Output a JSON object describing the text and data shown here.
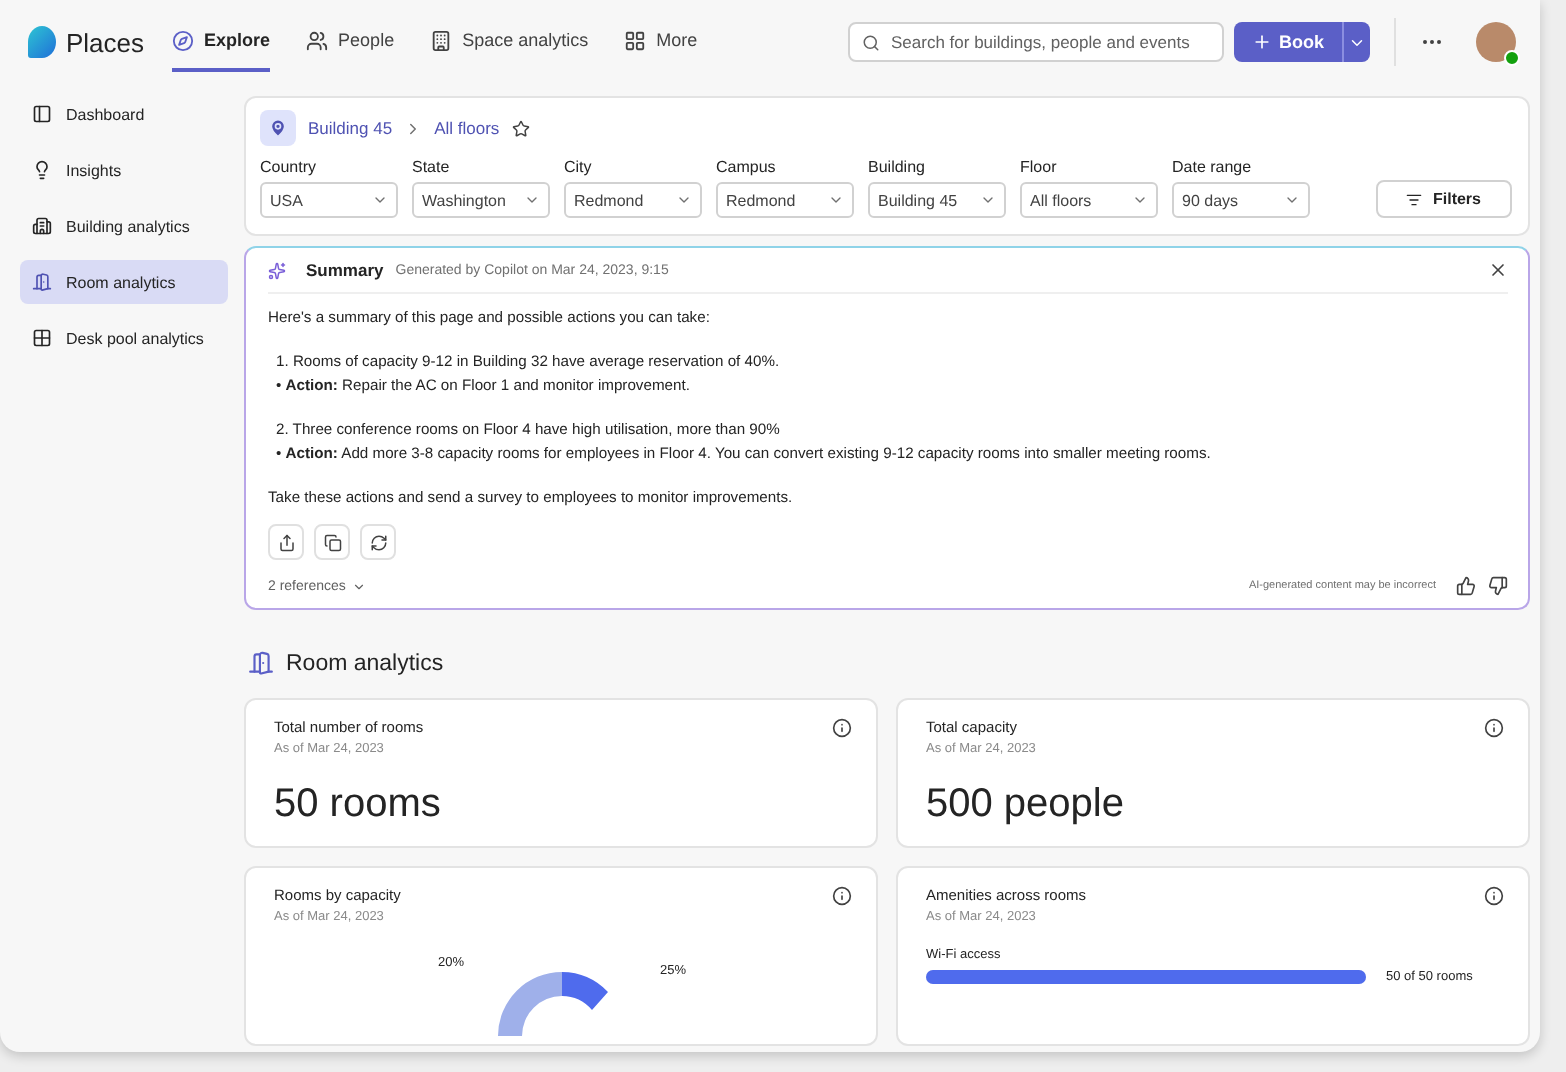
{
  "app": {
    "name": "Places"
  },
  "nav": [
    {
      "label": "Explore",
      "selected": true,
      "kind": "explore"
    },
    {
      "label": "People",
      "selected": false,
      "kind": "people"
    },
    {
      "label": "Space analytics",
      "selected": false,
      "kind": "analytics"
    },
    {
      "label": "More",
      "selected": false,
      "kind": "more"
    }
  ],
  "search": {
    "placeholder": "Search for buildings, people and events"
  },
  "book_button": "Book",
  "sidebar": {
    "items": [
      {
        "label": "Dashboard",
        "selected": false,
        "kind": "dashboard"
      },
      {
        "label": "Insights",
        "selected": false,
        "kind": "insights"
      },
      {
        "label": "Building analytics",
        "selected": false,
        "kind": "building"
      },
      {
        "label": "Room analytics",
        "selected": true,
        "kind": "room"
      },
      {
        "label": "Desk pool analytics",
        "selected": false,
        "kind": "desk"
      }
    ]
  },
  "breadcrumb": [
    "Building 45",
    "All floors"
  ],
  "filters": [
    {
      "label": "Country",
      "value": "USA"
    },
    {
      "label": "State",
      "value": "Washington"
    },
    {
      "label": "City",
      "value": "Redmond"
    },
    {
      "label": "Campus",
      "value": "Redmond"
    },
    {
      "label": "Building",
      "value": "Building 45"
    },
    {
      "label": "Floor",
      "value": "All floors"
    },
    {
      "label": "Date range",
      "value": "90 days"
    }
  ],
  "filters_button": "Filters",
  "summary": {
    "title": "Summary",
    "meta": "Generated by Copilot on Mar 24, 2023, 9:15",
    "intro": "Here's a summary of this page and possible actions you can take:",
    "items": [
      {
        "text": "1. Rooms of capacity 9-12 in Building 32 have average reservation of 40%.",
        "action": "• **Action:** Repair the AC on Floor 1 and monitor improvement."
      },
      {
        "text": "2. Three conference rooms on Floor 4 have high utilisation, more than 90%",
        "action": "• **Action:** Add more 3-8 capacity rooms for employees in Floor 4. You can convert existing 9-12 capacity rooms into smaller meeting rooms."
      }
    ],
    "closing": "Take these actions and send a survey to employees to monitor improvements.",
    "references": "2 references",
    "disclaimer": "AI-generated content may be incorrect"
  },
  "section_title": "Room analytics",
  "stats": [
    {
      "title": "Total number of rooms",
      "date": "As of Mar 24, 2023",
      "value": "50 rooms"
    },
    {
      "title": "Total capacity",
      "date": "As of Mar 24, 2023",
      "value": "500 people"
    }
  ],
  "capacity_card": {
    "title": "Rooms by capacity",
    "date": "As of Mar 24, 2023",
    "labels": [
      "20%",
      "25%"
    ]
  },
  "amenities_card": {
    "title": "Amenities across rooms",
    "date": "As of Mar 24, 2023",
    "rows": [
      {
        "label": "Wi-Fi access",
        "level": 1,
        "reading": "50 of 50 rooms"
      }
    ]
  }
}
